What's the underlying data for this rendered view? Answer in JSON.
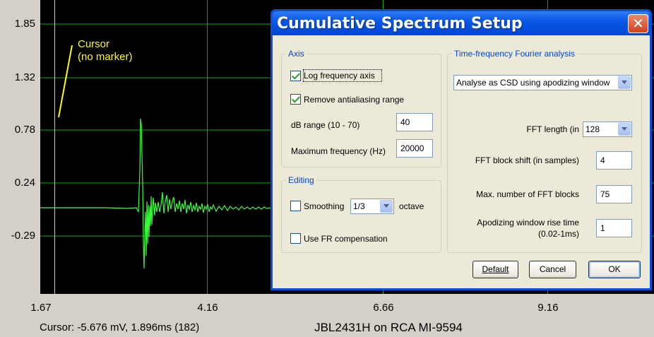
{
  "plot": {
    "y_ticks": [
      "1.85",
      "1.32",
      "0.78",
      "0.24",
      "-0.29"
    ],
    "x_ticks": [
      "1.67",
      "4.16",
      "6.66",
      "9.16"
    ],
    "cursor_label_line1": "Cursor",
    "cursor_label_line2": "(no marker)",
    "cursor_status": "Cursor: -5.676 mV, 1.896ms (182)",
    "title": "JBL2431H on RCA MI-9594",
    "colors": {
      "background": "#000000",
      "grid": "#00cc00",
      "trace": "#33ff33",
      "cursor": "#ffff00"
    }
  },
  "dialog": {
    "title": "Cumulative Spectrum Setup",
    "close_icon": "close-x",
    "axis": {
      "label": "Axis",
      "log_frequency": {
        "label": "Log frequency axis",
        "checked": true
      },
      "remove_antialiasing": {
        "label": "Remove antialiasing range",
        "checked": true
      },
      "db_range": {
        "label": "dB range (10 - 70)",
        "value": "40"
      },
      "max_frequency": {
        "label": "Maximum frequency (Hz)",
        "value": "20000"
      }
    },
    "editing": {
      "label": "Editing",
      "smoothing": {
        "label": "Smoothing",
        "checked": false,
        "value": "1/3",
        "suffix": "octave"
      },
      "fr_compensation": {
        "label": "Use FR compensation",
        "checked": false
      }
    },
    "tf_analysis": {
      "label": "Time-frequency Fourier analysis",
      "method": "Analyse as CSD using apodizing window",
      "fft_length": {
        "label": "FFT length (in",
        "value": "128"
      },
      "fft_block_shift": {
        "label": "FFT block shift (in samples)",
        "value": "4"
      },
      "max_fft_blocks": {
        "label": "Max. number of FFT blocks",
        "value": "75"
      },
      "rise_time": {
        "label_line1": "Apodizing window rise time",
        "label_line2": "(0.02-1ms)",
        "value": "1"
      }
    },
    "buttons": {
      "default": "Default",
      "cancel": "Cancel",
      "ok": "OK"
    }
  }
}
